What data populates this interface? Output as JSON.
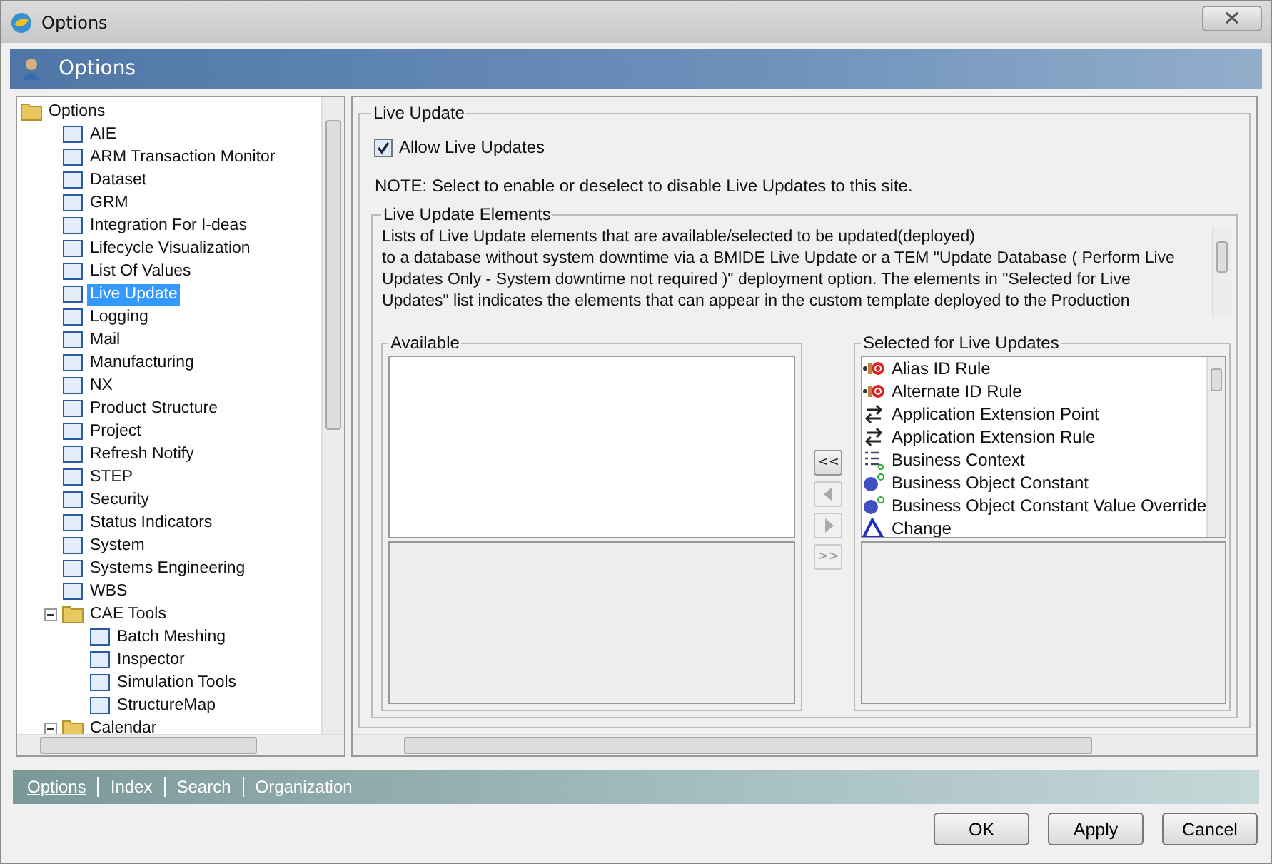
{
  "window": {
    "title": "Options"
  },
  "header": {
    "title": "Options"
  },
  "tree": [
    {
      "label": "Options",
      "kind": "folder",
      "selected": false,
      "children": [
        {
          "label": "AIE",
          "kind": "page",
          "selected": false
        },
        {
          "label": "ARM Transaction Monitor",
          "kind": "page",
          "selected": false
        },
        {
          "label": "Dataset",
          "kind": "page",
          "selected": false
        },
        {
          "label": "GRM",
          "kind": "page",
          "selected": false
        },
        {
          "label": "Integration For I-deas",
          "kind": "page",
          "selected": false
        },
        {
          "label": "Lifecycle Visualization",
          "kind": "page",
          "selected": false
        },
        {
          "label": "List Of Values",
          "kind": "page",
          "selected": false
        },
        {
          "label": "Live Update",
          "kind": "page",
          "selected": true
        },
        {
          "label": "Logging",
          "kind": "page",
          "selected": false
        },
        {
          "label": "Mail",
          "kind": "page",
          "selected": false
        },
        {
          "label": "Manufacturing",
          "kind": "page",
          "selected": false
        },
        {
          "label": "NX",
          "kind": "page",
          "selected": false
        },
        {
          "label": "Product Structure",
          "kind": "page",
          "selected": false
        },
        {
          "label": "Project",
          "kind": "page",
          "selected": false
        },
        {
          "label": "Refresh Notify",
          "kind": "page",
          "selected": false
        },
        {
          "label": "STEP",
          "kind": "page",
          "selected": false
        },
        {
          "label": "Security",
          "kind": "page",
          "selected": false
        },
        {
          "label": "Status Indicators",
          "kind": "page",
          "selected": false
        },
        {
          "label": "System",
          "kind": "page",
          "selected": false
        },
        {
          "label": "Systems Engineering",
          "kind": "page",
          "selected": false
        },
        {
          "label": "WBS",
          "kind": "page",
          "selected": false
        },
        {
          "label": "CAE Tools",
          "kind": "folder",
          "selected": false,
          "expanded": true,
          "children": [
            {
              "label": "Batch Meshing",
              "kind": "page",
              "selected": false
            },
            {
              "label": "Inspector",
              "kind": "page",
              "selected": false
            },
            {
              "label": "Simulation Tools",
              "kind": "page",
              "selected": false
            },
            {
              "label": "StructureMap",
              "kind": "page",
              "selected": false
            }
          ]
        },
        {
          "label": "Calendar",
          "kind": "folder",
          "selected": false,
          "expanded": true
        }
      ]
    }
  ],
  "panel": {
    "title": "Live Update",
    "allow": {
      "label": "Allow Live Updates",
      "checked": true
    },
    "note": "NOTE: Select to enable or deselect to disable Live Updates to this site.",
    "elements": {
      "title": "Live Update Elements",
      "description": "Lists of Live Update elements that are available/selected to be updated(deployed)\nto a database without system downtime via a BMIDE Live Update or a TEM \"Update Database ( Perform Live\nUpdates Only - System downtime not required )\" deployment option. The elements in \"Selected for Live\nUpdates\" list indicates the elements that can appear in the custom template deployed to the Production",
      "available": {
        "title": "Available"
      },
      "transfer": [
        {
          "kind": "text",
          "label": "<<",
          "disabled": false
        },
        {
          "kind": "left",
          "disabled": true
        },
        {
          "kind": "right",
          "disabled": true
        },
        {
          "kind": "text",
          "label": ">>",
          "disabled": true
        }
      ],
      "selected_list": {
        "title": "Selected for Live Updates",
        "items": [
          {
            "label": "Alias ID Rule",
            "kind": "rule"
          },
          {
            "label": "Alternate ID Rule",
            "kind": "rule"
          },
          {
            "label": "Application Extension Point",
            "kind": "extension"
          },
          {
            "label": "Application Extension Rule",
            "kind": "extension"
          },
          {
            "label": "Business Context",
            "kind": "context"
          },
          {
            "label": "Business Object Constant",
            "kind": "constant"
          },
          {
            "label": "Business Object Constant Value Override",
            "kind": "constant"
          },
          {
            "label": "Change",
            "kind": "change"
          }
        ]
      }
    }
  },
  "bottom_tabs": [
    {
      "label": "Options",
      "selected": true
    },
    {
      "label": "Index",
      "selected": false
    },
    {
      "label": "Search",
      "selected": false
    },
    {
      "label": "Organization",
      "selected": false
    }
  ],
  "buttons": [
    "OK",
    "Apply",
    "Cancel"
  ]
}
